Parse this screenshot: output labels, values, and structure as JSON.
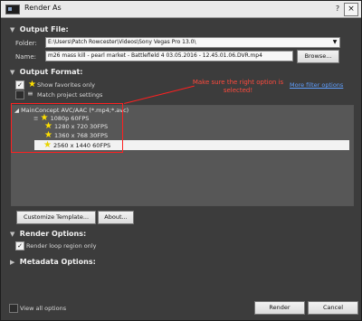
{
  "window": {
    "title": "Render As",
    "help": "?",
    "close": "×"
  },
  "output_file": {
    "header": "Output File:",
    "folder_label": "Folder:",
    "folder_value": "E:\\Users\\Patch Rowcester\\Videos\\Sony Vegas Pro 13.0\\",
    "name_label": "Name:",
    "name_value": "m26 mass kill - pearl market - Battlefield 4 03.05.2016 - 12.45.01.06.DVR.mp4",
    "browse": "Browse..."
  },
  "output_format": {
    "header": "Output Format:",
    "show_favorites": "Show favorites only",
    "match_project": "Match project settings",
    "more_filter": "More filter options",
    "tree_root": "MainConcept AVC/AAC (*.mp4;*.avc)",
    "templates": [
      "1080p 60FPS",
      "1280 x 720 30FPS",
      "1360 x 768 30FPS",
      "2560 x 1440 60FPS"
    ]
  },
  "annotation": {
    "text": "Make sure the right option is selected!"
  },
  "buttons": {
    "customize": "Customize Template...",
    "about": "About...",
    "render": "Render",
    "cancel": "Cancel"
  },
  "render_options": {
    "header": "Render Options:",
    "render_loop": "Render loop region only"
  },
  "metadata": {
    "header": "Metadata Options:"
  },
  "footer": {
    "view_all": "View all options"
  }
}
